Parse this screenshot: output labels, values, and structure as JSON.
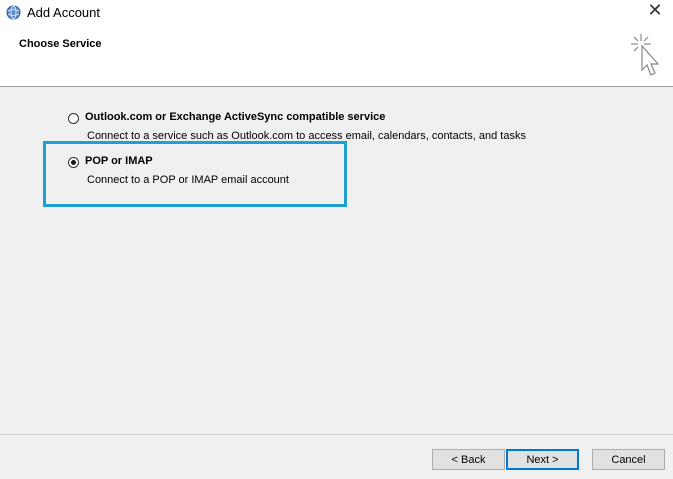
{
  "window": {
    "title": "Add Account",
    "close_glyph": "✕"
  },
  "header": {
    "title": "Choose Service"
  },
  "options": [
    {
      "label": "Outlook.com or Exchange ActiveSync compatible service",
      "description": "Connect to a service such as Outlook.com to access email, calendars, contacts, and tasks",
      "selected": false
    },
    {
      "label": "POP or IMAP",
      "description": "Connect to a POP or IMAP email account",
      "selected": true
    }
  ],
  "buttons": {
    "back": "< Back",
    "next": "Next >",
    "cancel": "Cancel"
  },
  "colors": {
    "highlight": "#1ea0d2",
    "default_button_border": "#0078d7"
  },
  "icons": {
    "app": "outlook-globe-icon",
    "header": "click-cursor-icon"
  }
}
